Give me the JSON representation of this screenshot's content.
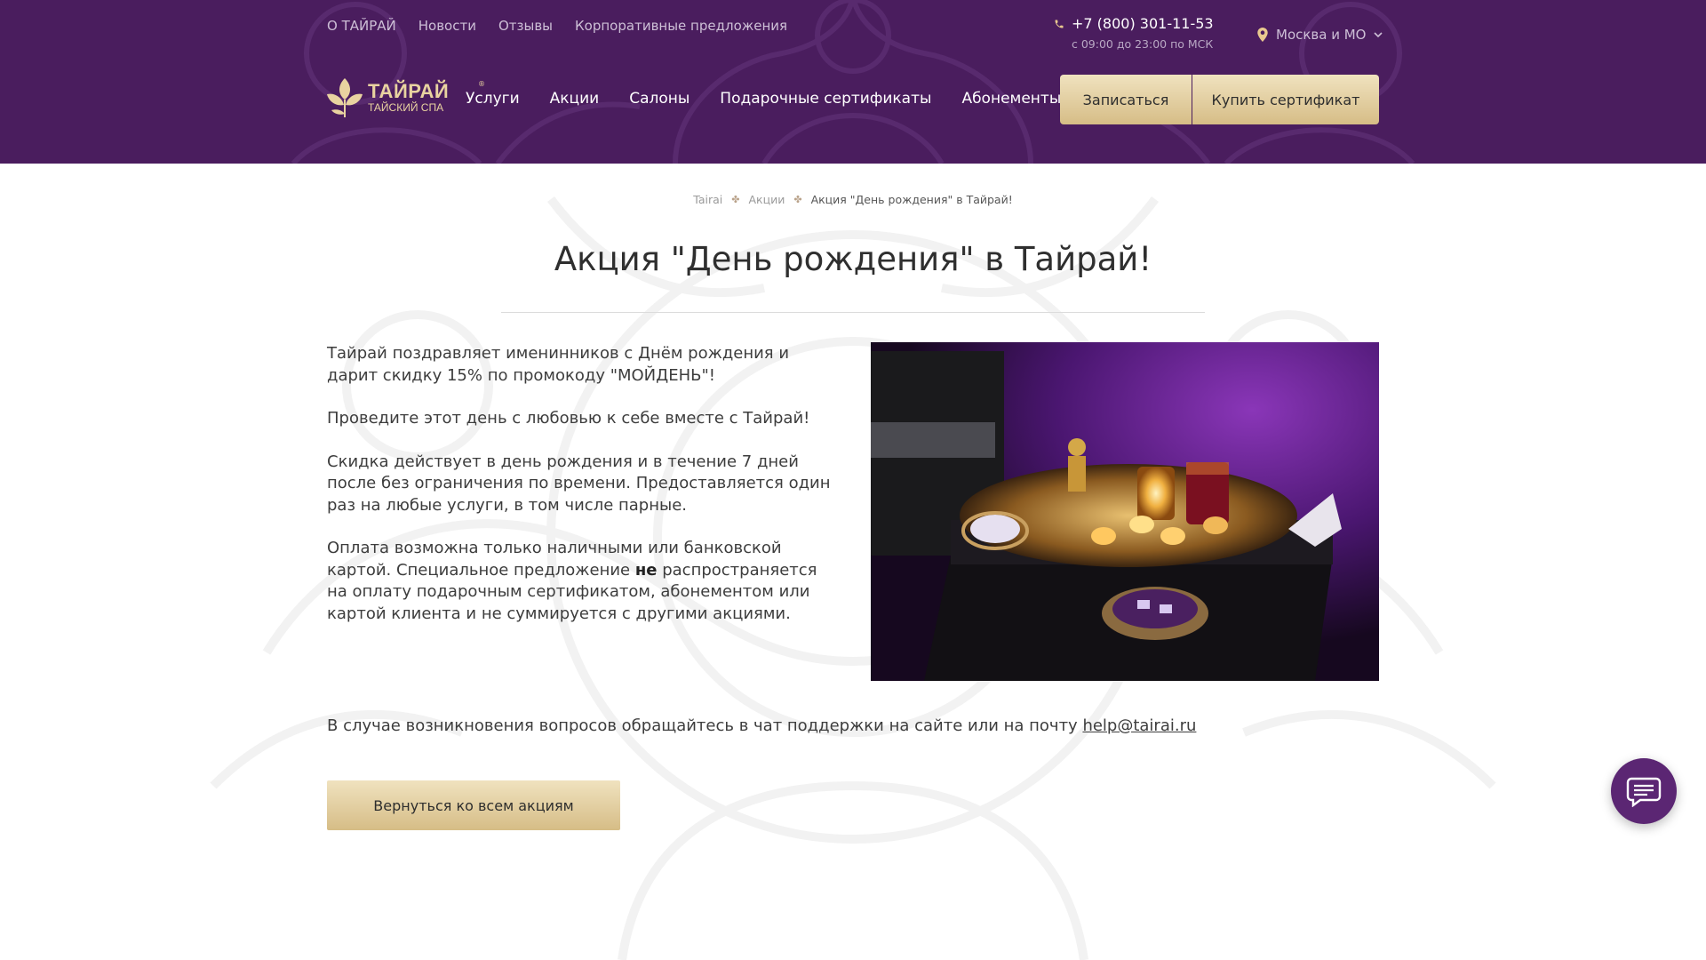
{
  "top_nav": {
    "items": [
      "О ТАЙРАЙ",
      "Новости",
      "Отзывы",
      "Корпоративные предложения"
    ]
  },
  "contact": {
    "phone": "+7 (800) 301-11-53",
    "hours": "с 09:00 до 23:00 по МСК"
  },
  "city": {
    "label": "Москва и МО"
  },
  "logo": {
    "main": "ТАЙРАЙ",
    "sub": "ТАЙСКИЙ СПА",
    "reg": "®"
  },
  "main_nav": {
    "items": [
      "Услуги",
      "Акции",
      "Салоны",
      "Подарочные сертификаты",
      "Абонементы"
    ]
  },
  "header_buttons": {
    "book": "Записаться",
    "certificate": "Купить сертификат"
  },
  "breadcrumb": {
    "home": "Tairai",
    "section": "Акции",
    "current": "Акция \"День рождения\" в Тайрай!"
  },
  "page": {
    "title": "Акция \"День рождения\" в Тайрай!",
    "paragraph1": "Тайрай поздравляет именинников с Днём рождения и дарит скидку 15% по промокоду \"МОЙДЕНЬ\"!",
    "paragraph2": "Проведите этот день с любовью к себе вместе с Тайрай!",
    "paragraph3": "Скидка действует в день рождения и в течение 7 дней после без ограничения по времени. Предоставляется один раз на любые услуги, в том числе парные.",
    "paragraph4_part1": "Оплата возможна только наличными или банковской картой. Специальное предложение ",
    "paragraph4_bold": "не",
    "paragraph4_part2": " распространяется на оплату подарочным сертификатом, абонементом или картой клиента и не суммируется с другими акциями.",
    "contact_text": "В случае возникновения вопросов обращайтесь в чат поддержки на сайте или на почту ",
    "contact_email": "help@tairai.ru",
    "back_button": "Вернуться ко всем акциям"
  },
  "icons": {
    "phone": "phone-icon",
    "location": "location-pin-icon",
    "chevron": "chevron-down-icon",
    "chat": "chat-bubble-icon",
    "logo": "lotus-leaves-icon"
  },
  "colors": {
    "header_bg": "#4a1d5e",
    "gold_light": "#f0e2bf",
    "gold_dark": "#d6bd86",
    "chat_fab": "#5b2673",
    "accent_gold": "#e9d3a0"
  }
}
